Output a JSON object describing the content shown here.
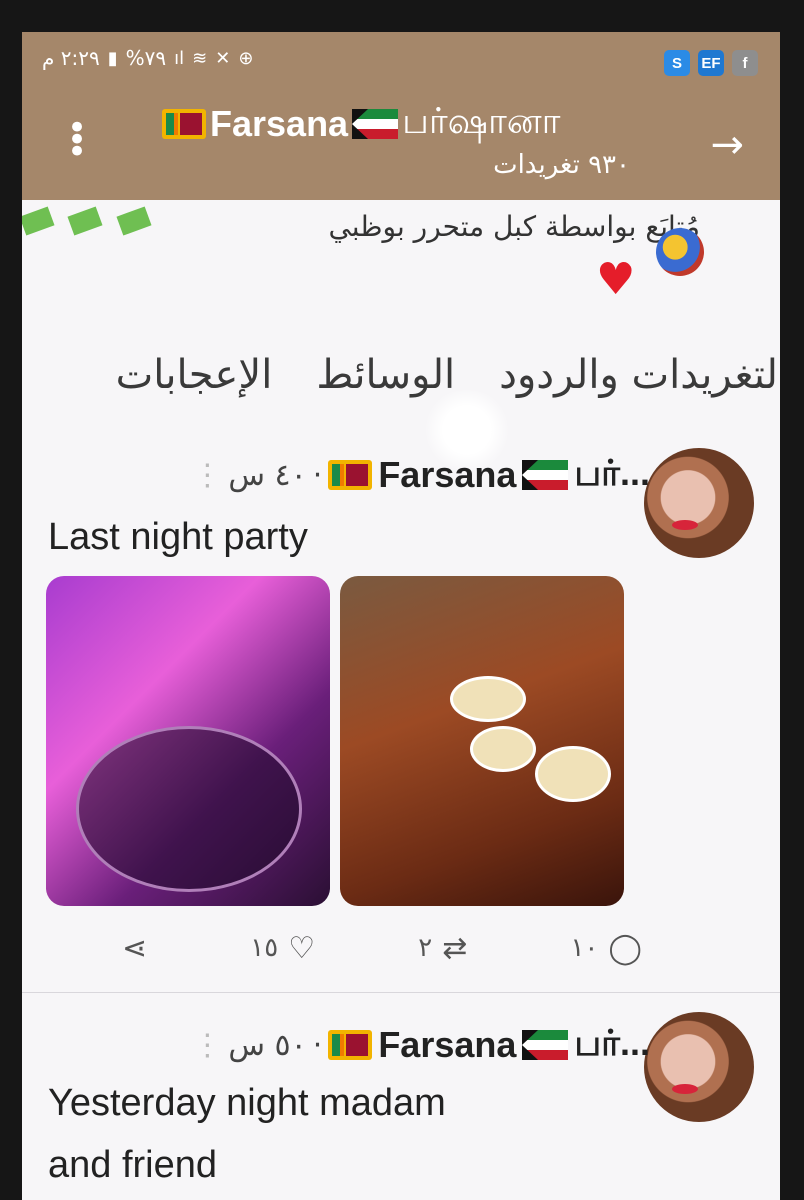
{
  "status_bar": {
    "time": "٢:٢٩ م",
    "battery": "%٧٩",
    "apps": [
      "S",
      "EF",
      "f"
    ]
  },
  "header": {
    "title_prefix": "Farsana",
    "title_suffix": "பர்ஷானா",
    "subtitle": "٩٣٠ تغريدات"
  },
  "follow_note": "مُتابَع بواسطة كبل متحرر بوظبي",
  "tabs": [
    "لتغريدات والردود",
    "الوسائط",
    "الإعجابات"
  ],
  "tweets": [
    {
      "name": "Farsana",
      "name_suffix": "பர்...",
      "time": "٤٠ س",
      "text": "Last night party",
      "replies": "١٠",
      "retweets": "٢",
      "likes": "١٥"
    },
    {
      "name": "Farsana",
      "name_suffix": "பர்...",
      "time": "٥٠ س",
      "text_line1": "Yesterday night madam",
      "text_line2": "and friend"
    }
  ],
  "colors": {
    "header_bg": "#a5876a",
    "heart": "#e51d2a"
  }
}
